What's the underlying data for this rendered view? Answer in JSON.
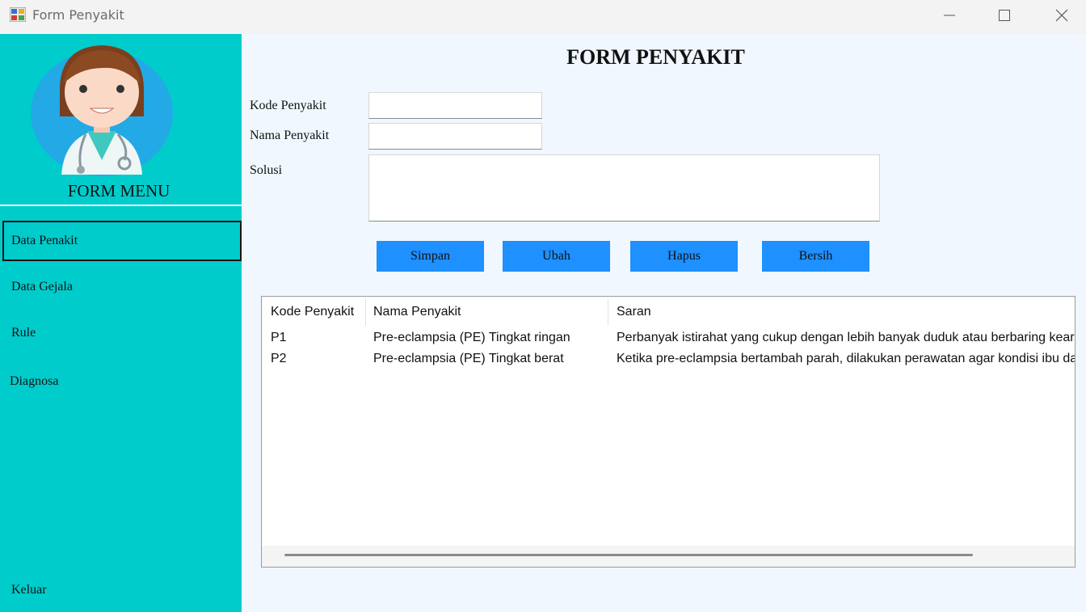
{
  "window": {
    "title": "Form Penyakit",
    "icon": "app-form-icon"
  },
  "sidebar": {
    "title": "FORM MENU",
    "avatar": "doctor-avatar",
    "items": [
      {
        "label": "Data Penakit",
        "active": true
      },
      {
        "label": "Data Gejala",
        "active": false
      },
      {
        "label": "Rule",
        "active": false
      },
      {
        "label": "Diagnosa",
        "active": false
      }
    ],
    "exit_label": "Keluar"
  },
  "form": {
    "title": "FORM PENYAKIT",
    "kode_label": "Kode Penyakit",
    "kode_value": "",
    "nama_label": "Nama Penyakit",
    "nama_value": "",
    "solusi_label": "Solusi",
    "solusi_value": ""
  },
  "buttons": {
    "simpan": "Simpan",
    "ubah": "Ubah",
    "hapus": "Hapus",
    "bersih": "Bersih"
  },
  "table": {
    "columns": [
      "Kode Penyakit",
      "Nama Penyakit",
      "Saran"
    ],
    "rows": [
      [
        "P1",
        "Pre-eclampsia (PE) Tingkat ringan",
        "Perbanyak istirahat yang cukup dengan lebih banyak duduk atau berbaring kearah kiri"
      ],
      [
        "P2",
        "Pre-eclampsia (PE) Tingkat berat",
        "Ketika pre-eclampsia bertambah parah, dilakukan perawatan agar kondisi ibu dan janin"
      ]
    ]
  },
  "colors": {
    "sidebar": "#00cccc",
    "main_bg": "#f0f7fe",
    "button": "#1e90ff"
  }
}
